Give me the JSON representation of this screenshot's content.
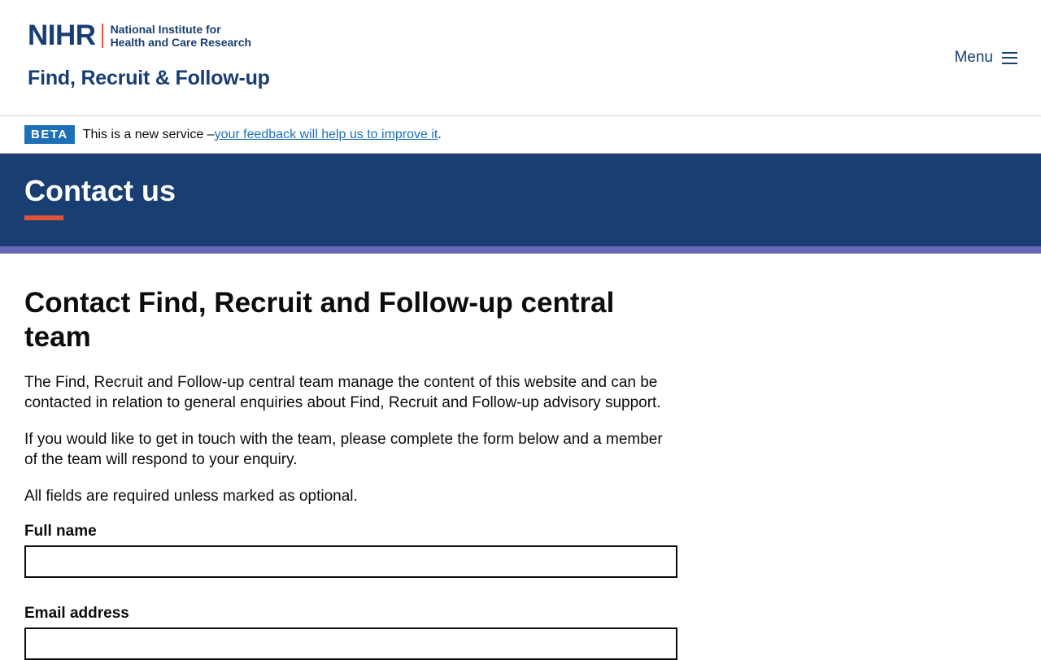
{
  "header": {
    "logo_mark": "NIHR",
    "logo_text_line1": "National Institute for",
    "logo_text_line2": "Health and Care Research",
    "service_name": "Find, Recruit & Follow-up",
    "menu_label": "Menu"
  },
  "beta_banner": {
    "tag": "BETA",
    "text": "This is a new service – ",
    "link": "your feedback will help us to improve it",
    "suffix": "."
  },
  "hero": {
    "title": "Contact us"
  },
  "main": {
    "heading": "Contact Find, Recruit and Follow-up central team",
    "paragraphs": [
      "The Find, Recruit and Follow-up central team manage the content of this website and can be contacted in relation to general enquiries about Find, Recruit and Follow-up advisory support.",
      "If you would like to get in touch with the team, please complete the form below and a member of the team will respond to your enquiry.",
      "All fields are required unless marked as optional."
    ],
    "fields": [
      {
        "label": "Full name",
        "value": ""
      },
      {
        "label": "Email address",
        "value": ""
      }
    ]
  },
  "colors": {
    "brand_navy": "#193e72",
    "accent_red": "#e1523d",
    "stripe_purple": "#6b68b3",
    "link_blue": "#1d70b8"
  }
}
